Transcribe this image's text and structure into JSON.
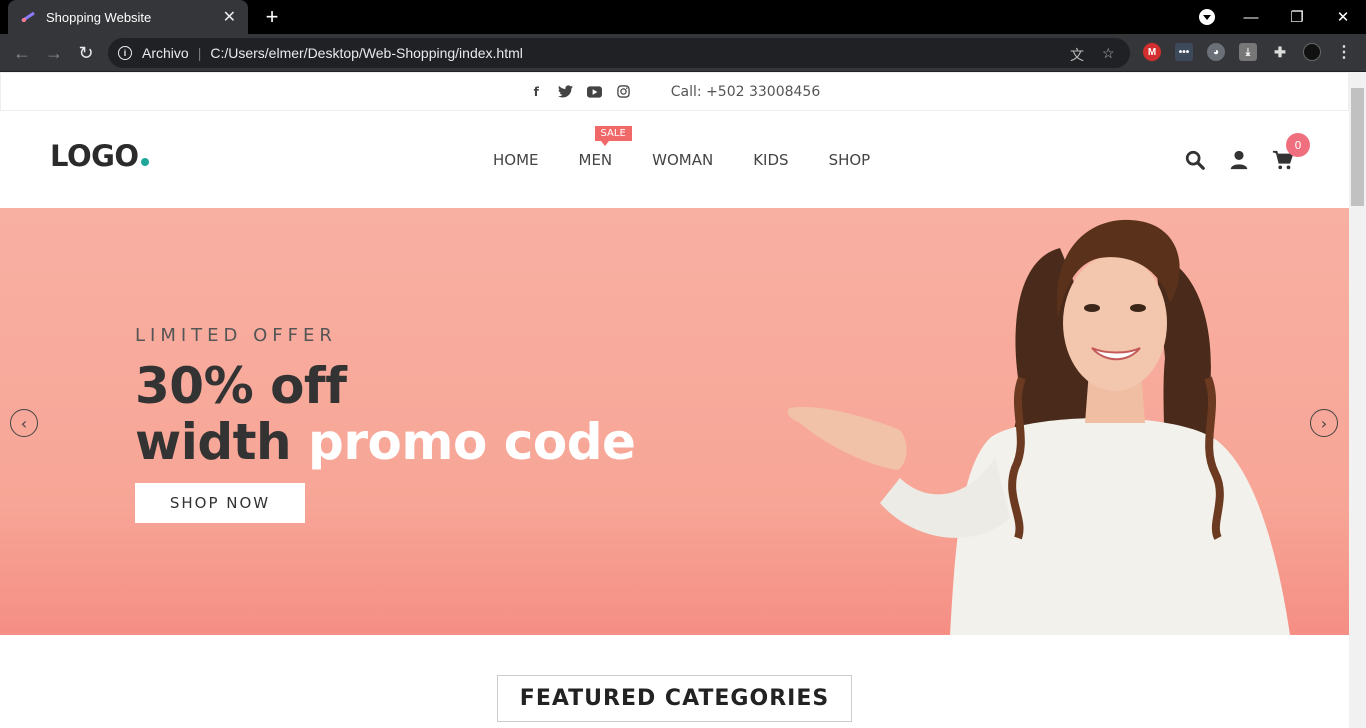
{
  "browser": {
    "tab_title": "Shopping Website",
    "address_label": "Archivo",
    "address_url": "C:/Users/elmer/Desktop/Web-Shopping/index.html"
  },
  "topbar": {
    "social_icons": [
      "facebook-icon",
      "twitter-icon",
      "youtube-icon",
      "instagram-icon"
    ],
    "phone": "Call: +502 33008456"
  },
  "header": {
    "logo": "LOGO",
    "menu": [
      "HOME",
      "MEN",
      "WOMAN",
      "KIDS",
      "SHOP"
    ],
    "sale_badge": "SALE",
    "cart_count": "0"
  },
  "hero": {
    "kicker": "LIMITED OFFER",
    "line1": "30% off",
    "line2_dark": "width",
    "line2_light": "promo code",
    "button": "SHOP NOW"
  },
  "featured": {
    "title": "FEATURED CATEGORIES"
  },
  "colors": {
    "accent": "#f06868",
    "logo_dot": "#1fa89a",
    "hero_bg": "#f8b0a2"
  }
}
